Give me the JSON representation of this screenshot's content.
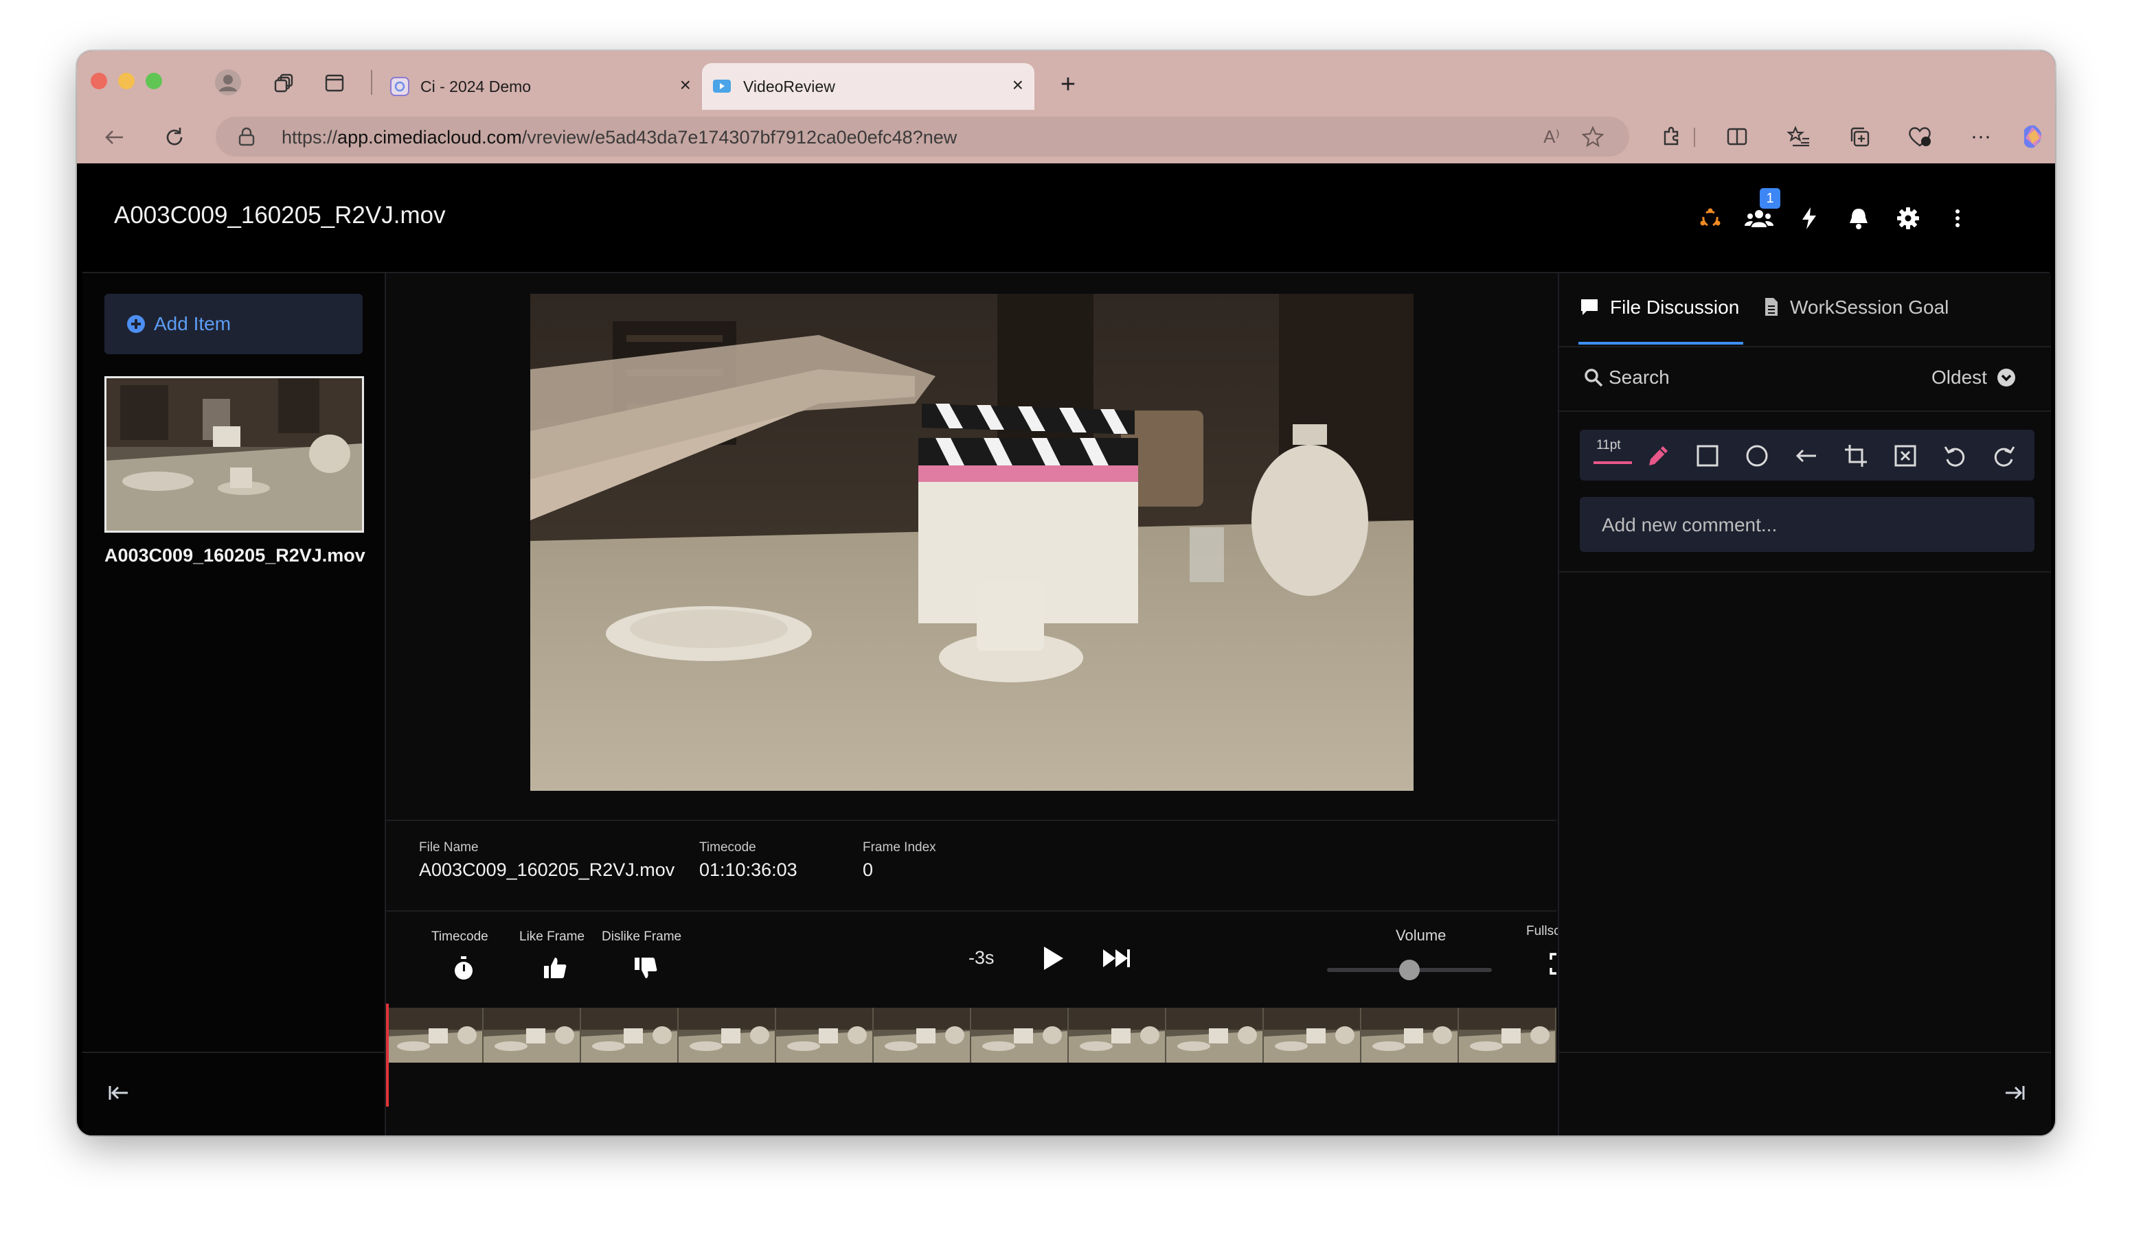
{
  "browser": {
    "tabs": [
      {
        "title": "Ci - 2024 Demo"
      },
      {
        "title": "VideoReview"
      }
    ],
    "url_prefix": "https://",
    "url_domain": "app.cimediacloud.com",
    "url_path": "/vreview/e5ad43da7e174307bf7912ca0e0efc48?new",
    "read_aloud_label": "A⁾",
    "more_label": "···"
  },
  "header": {
    "file_title": "A003C009_160205_R2VJ.mov",
    "users_badge": "1"
  },
  "sidebar": {
    "add_item_label": "Add Item",
    "thumbnail_caption": "A003C009_160205_R2VJ.mov"
  },
  "info": {
    "file_name_label": "File Name",
    "file_name_value": "A003C009_160205_R2VJ.mov",
    "timecode_label": "Timecode",
    "timecode_value": "01:10:36:03",
    "frame_index_label": "Frame Index",
    "frame_index_value": "0"
  },
  "controls": {
    "timecode_label": "Timecode",
    "like_label": "Like Frame",
    "dislike_label": "Dislike Frame",
    "rewind_label": "-3s",
    "volume_label": "Volume",
    "volume_level": 0.5,
    "fullscreen_label": "Fullscreen"
  },
  "discussion": {
    "tab_discussion": "File Discussion",
    "tab_goal": "WorkSession Goal",
    "search_label": "Search",
    "sort_label": "Oldest",
    "pen_size": "11pt",
    "comment_placeholder": "Add new comment..."
  },
  "colors": {
    "accent_blue": "#3f8ff7",
    "pen_pink": "#e8578a",
    "badge_blue": "#3d86f5",
    "playhead_red": "#e0343a",
    "org_orange": "#f08a24"
  }
}
